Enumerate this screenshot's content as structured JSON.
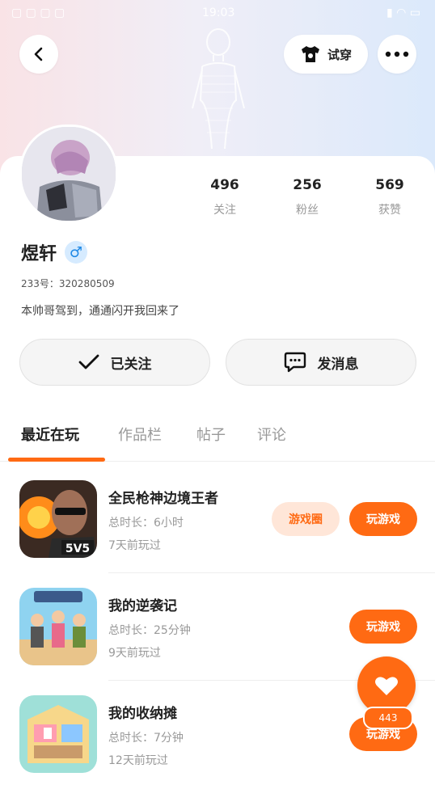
{
  "status_bar": {
    "carrier": "▢ ▢ ▢ ▢",
    "time": "19:03",
    "icons": "▮ ◠ ▭"
  },
  "header": {
    "back_icon": "chevron-left-icon",
    "try_on_label": "试穿",
    "more_icon": "more-icon"
  },
  "profile": {
    "name": "煜轩",
    "gender_symbol": "♂",
    "uid_text": "233号：320280509",
    "bio": "本帅哥驾到，通通闪开我回来了",
    "stats": [
      {
        "value": "496",
        "label": "关注"
      },
      {
        "value": "256",
        "label": "粉丝"
      },
      {
        "value": "569",
        "label": "获赞"
      }
    ]
  },
  "actions": {
    "follow_label": "已关注",
    "message_label": "发消息"
  },
  "tabs": [
    {
      "label": "最近在玩",
      "active": true
    },
    {
      "label": "作品栏",
      "active": false
    },
    {
      "label": "帖子",
      "active": false
    },
    {
      "label": "评论",
      "active": false
    }
  ],
  "games": [
    {
      "title": "全民枪神边境王者",
      "duration": "总时长：6小时",
      "last_played": "7天前玩过",
      "circle_label": "游戏圈",
      "play_label": "玩游戏"
    },
    {
      "title": "我的逆袭记",
      "duration": "总时长：25分钟",
      "last_played": "9天前玩过",
      "play_label": "玩游戏"
    },
    {
      "title": "我的收纳摊",
      "duration": "总时长：7分钟",
      "last_played": "12天前玩过",
      "play_label": "玩游戏"
    }
  ],
  "like": {
    "count": "443"
  },
  "colors": {
    "accent": "#ff6a13",
    "accent_soft": "#ffe6d8"
  }
}
